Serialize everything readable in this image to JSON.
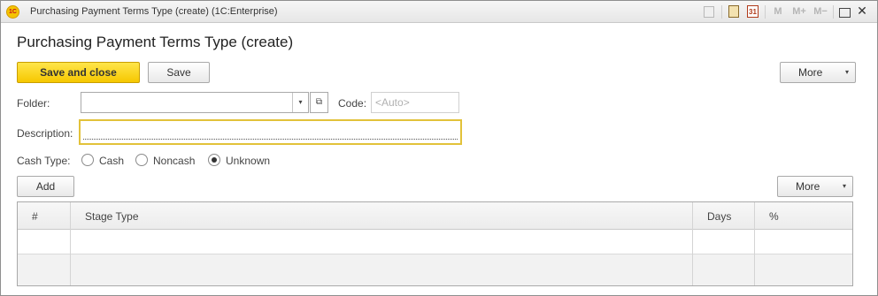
{
  "window": {
    "title": "Purchasing Payment Terms Type (create)  (1C:Enterprise)",
    "app_icon_text": "1C",
    "toolbar": {
      "calendar_day": "31",
      "m_label": "M",
      "m_plus_label": "M+",
      "m_minus_label": "M−",
      "close_glyph": "✕"
    }
  },
  "form": {
    "title": "Purchasing Payment Terms Type (create)",
    "buttons": {
      "save_and_close": "Save and close",
      "save": "Save",
      "more": "More"
    },
    "fields": {
      "folder_label": "Folder:",
      "folder_value": "",
      "code_label": "Code:",
      "code_placeholder": "<Auto>",
      "description_label": "Description:",
      "description_value": ""
    },
    "cash_type": {
      "label": "Cash Type:",
      "options": [
        "Cash",
        "Noncash",
        "Unknown"
      ],
      "selected": "Unknown"
    },
    "stages": {
      "add_label": "Add",
      "more_label": "More",
      "columns": [
        "#",
        "Stage Type",
        "Days",
        "%"
      ],
      "rows": []
    }
  },
  "icons": {
    "dropdown_arrow": "▾",
    "open_glyph": "⧉"
  }
}
